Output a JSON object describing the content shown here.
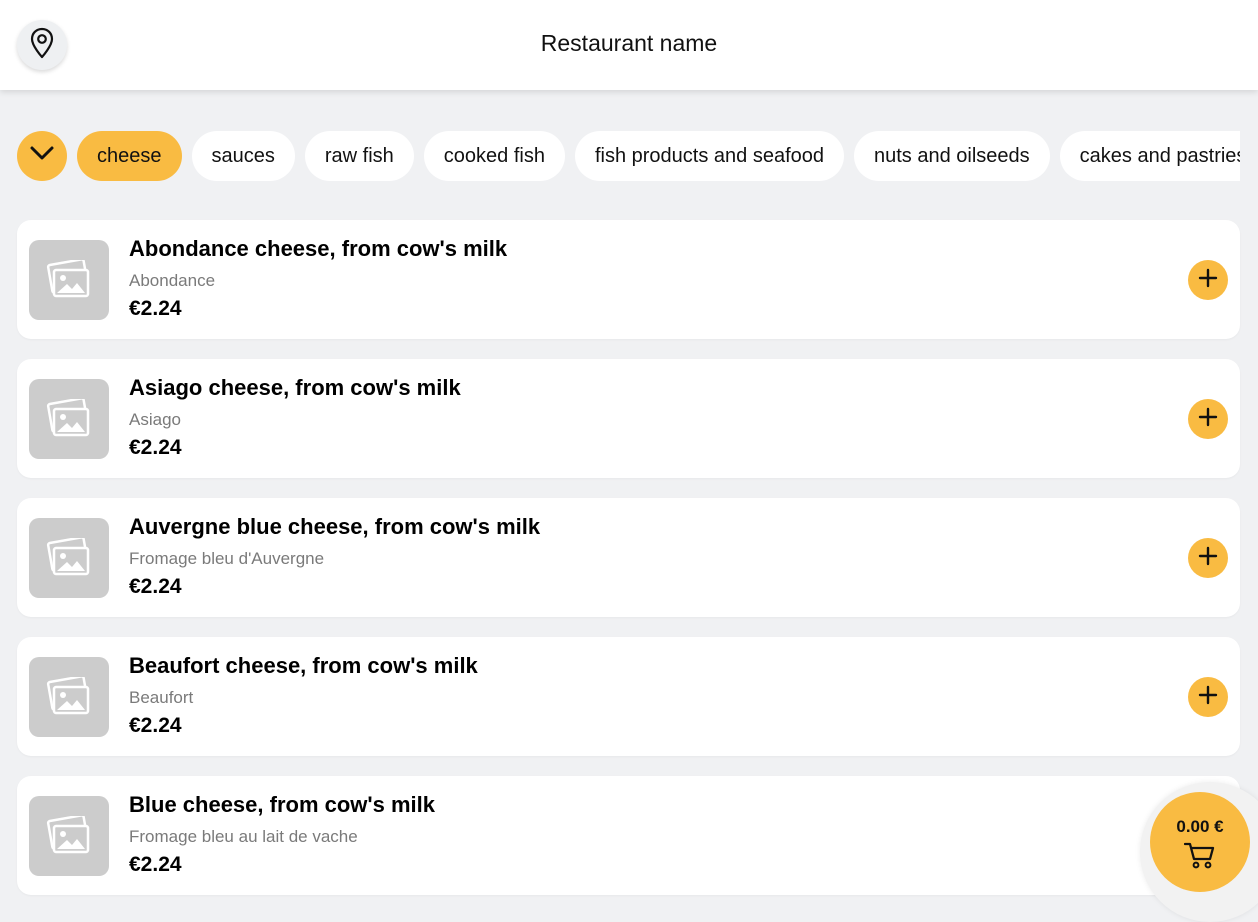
{
  "header": {
    "title": "Restaurant name",
    "location_icon": "map-pin-icon"
  },
  "categories": {
    "toggle_icon": "chevron-down-icon",
    "items": [
      {
        "label": "cheese",
        "active": true
      },
      {
        "label": "sauces",
        "active": false
      },
      {
        "label": "raw fish",
        "active": false
      },
      {
        "label": "cooked fish",
        "active": false
      },
      {
        "label": "fish products and seafood",
        "active": false
      },
      {
        "label": "nuts and oilseeds",
        "active": false
      },
      {
        "label": "cakes and pastries",
        "active": false
      }
    ]
  },
  "products": [
    {
      "name": "Abondance cheese, from cow's milk",
      "subtitle": "Abondance",
      "price": "€2.24"
    },
    {
      "name": "Asiago cheese, from cow's milk",
      "subtitle": "Asiago",
      "price": "€2.24"
    },
    {
      "name": "Auvergne blue cheese, from cow's milk",
      "subtitle": "Fromage bleu d'Auvergne",
      "price": "€2.24"
    },
    {
      "name": "Beaufort cheese, from cow's milk",
      "subtitle": "Beaufort",
      "price": "€2.24"
    },
    {
      "name": "Blue cheese, from cow's milk",
      "subtitle": "Fromage bleu au lait de vache",
      "price": "€2.24"
    }
  ],
  "cart": {
    "total": "0.00 €",
    "icon": "shopping-cart-icon"
  },
  "colors": {
    "accent": "#f9bb42",
    "background": "#f0f1f3",
    "card": "#ffffff",
    "placeholder": "#cccccc",
    "muted_text": "#7a7a7a"
  }
}
